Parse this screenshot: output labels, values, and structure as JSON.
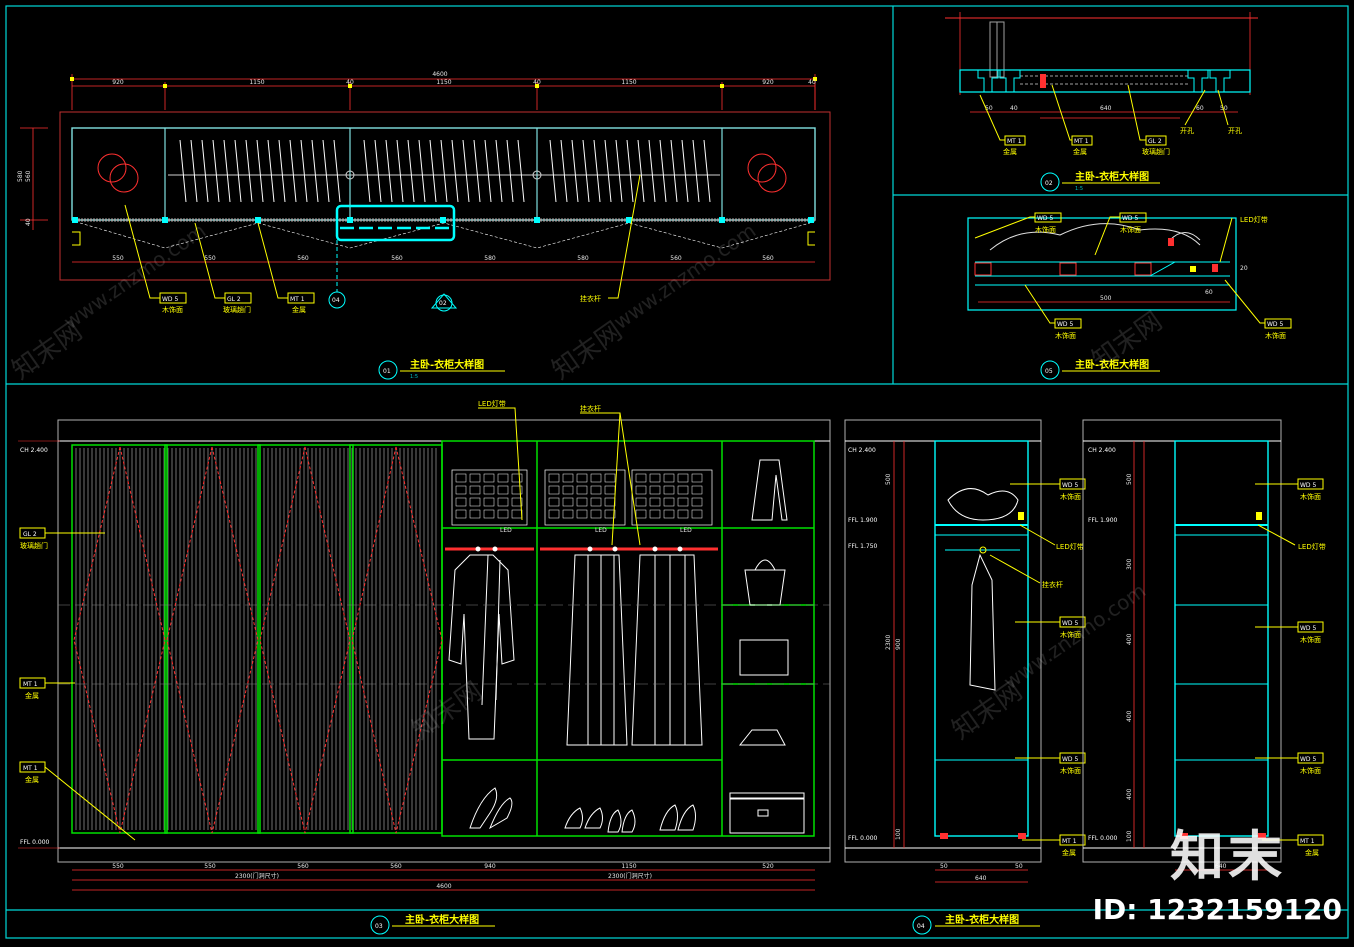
{
  "colors": {
    "frame": "#00d8d8",
    "dimension": "#ff3030",
    "leader": "#ffff00",
    "cabinet": "#00e000",
    "panel": "#00ffff",
    "text": "#ffffff",
    "hatch": "#a0a0a0"
  },
  "titles": {
    "t01": "主卧-衣柜大样图",
    "t02": "主卧-衣柜大样图",
    "t03": "主卧-衣柜大样图",
    "t04": "主卧-衣柜大样图",
    "t05": "主卧-衣柜大样图"
  },
  "view_numbers": {
    "v01": "01",
    "v02": "02",
    "v03": "03",
    "v04": "04",
    "v05": "05"
  },
  "scale_labels": {
    "s1": "1:5",
    "s2": "1:5"
  },
  "top_plan": {
    "overall": "4600",
    "segments": [
      "920",
      "1150",
      "40",
      "1150",
      "40",
      "1150",
      "920",
      "40"
    ],
    "bottom_segments": [
      "550",
      "550",
      "560",
      "560",
      "580",
      "580",
      "560",
      "560"
    ],
    "height_dims": [
      "580",
      "560",
      "40"
    ],
    "callouts": [
      {
        "code": "WD 5",
        "text": "木饰面"
      },
      {
        "code": "GL 2",
        "text": "玻璃趟门"
      },
      {
        "code": "MT 1",
        "text": "金属"
      }
    ],
    "rod_label": "挂衣杆",
    "markers": [
      "04",
      "02"
    ]
  },
  "section_details": {
    "detail1_dims": [
      "50",
      "40",
      "640",
      "60",
      "50"
    ],
    "detail1_callouts": [
      {
        "code": "MT 1",
        "text": "金属"
      },
      {
        "code": "MT 1",
        "text": "金属"
      },
      {
        "code": "GL 2",
        "text": "玻璃趟门"
      }
    ],
    "detail1_notes": [
      "开孔",
      "开孔"
    ],
    "detail2_callouts": [
      {
        "code": "WD 5",
        "text": "木饰面"
      },
      {
        "code": "WD 5",
        "text": "木饰面"
      },
      {
        "code": "WD 5",
        "text": "木饰面"
      },
      {
        "code": "WD 5",
        "text": "木饰面"
      }
    ],
    "detail2_notes": [
      "LED灯带"
    ],
    "detail2_dims": [
      "500",
      "60",
      "20"
    ]
  },
  "elevation": {
    "level_labels": [
      "CH 2.400",
      "FFL 0.000"
    ],
    "callouts_left": [
      {
        "code": "GL 2",
        "text": "玻璃趟门"
      },
      {
        "code": "MT 1",
        "text": "金属"
      },
      {
        "code": "MT 1",
        "text": "金属"
      }
    ],
    "top_notes": [
      "LED灯带",
      "挂衣杆"
    ],
    "bottom_dims": [
      "550",
      "550",
      "560",
      "560",
      "940",
      "1150",
      "520"
    ],
    "total_dims": [
      "2300(门洞尺寸)",
      "2300(门洞尺寸)"
    ],
    "overall": "4600",
    "led_small": [
      "LED",
      "LED",
      "LED"
    ]
  },
  "side_section": {
    "level_labels": [
      "CH 2.400",
      "FFL 1.900",
      "FFL 1.750",
      "FFL 0.000"
    ],
    "callouts": [
      {
        "code": "WD 5",
        "text": "木饰面"
      },
      {
        "code": "WD 5",
        "text": "木饰面"
      },
      {
        "code": "WD 5",
        "text": "木饰面"
      },
      {
        "code": "MT 1",
        "text": "金属"
      }
    ],
    "notes": [
      "LED灯带",
      "挂衣杆"
    ],
    "height_dims": [
      "500",
      "2300",
      "900",
      "100"
    ],
    "width_dims": [
      "50",
      "640",
      "50"
    ]
  },
  "side_section2": {
    "level_labels": [
      "CH 2.400",
      "FFL 1.900",
      "FFL 0.000"
    ],
    "callouts": [
      {
        "code": "WD 5",
        "text": "木饰面"
      },
      {
        "code": "WD 5",
        "text": "木饰面"
      },
      {
        "code": "WD 5",
        "text": "木饰面"
      },
      {
        "code": "MT 1",
        "text": "金属"
      }
    ],
    "notes": [
      "LED灯带"
    ],
    "height_dims": [
      "500",
      "300",
      "400",
      "400",
      "400",
      "100"
    ],
    "width_dims": [
      "640"
    ]
  },
  "watermark": {
    "brand": "知末",
    "site": "www.znzmo.com",
    "cn": "知末网"
  },
  "asset_id": "ID: 1232159120"
}
